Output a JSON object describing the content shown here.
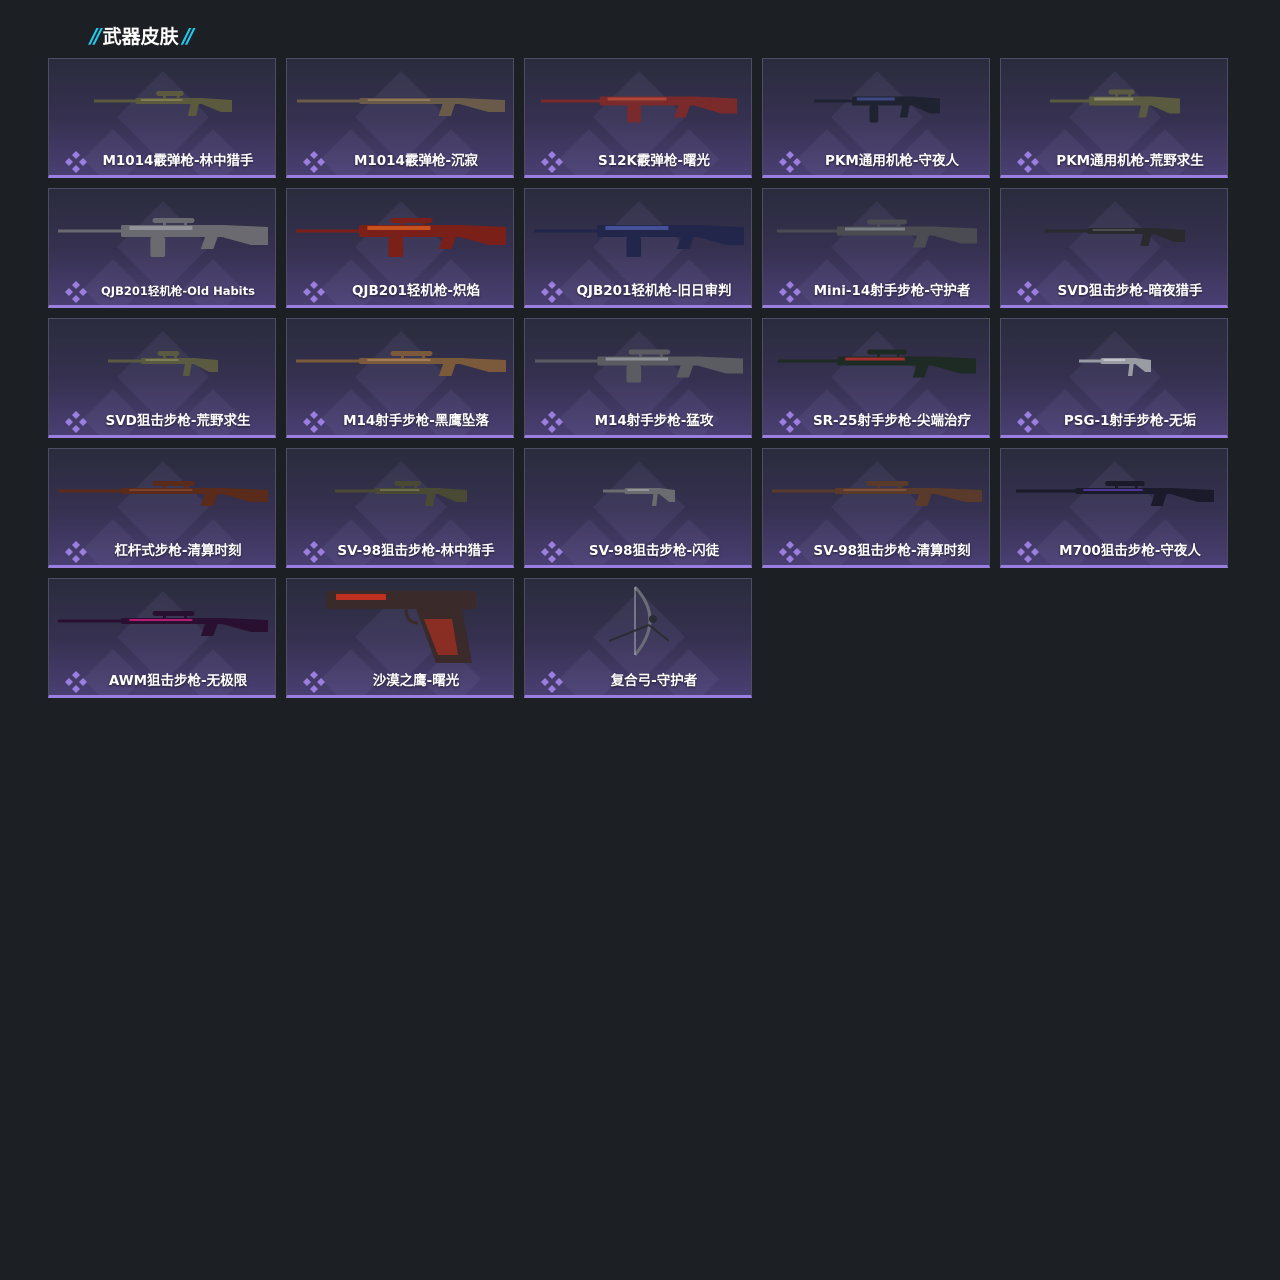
{
  "section": {
    "title": "武器皮肤",
    "accent": "#1ecbf0"
  },
  "card_style": {
    "rarity_color": "#9b7fe0",
    "border_color": "#4e4d66"
  },
  "skins": [
    {
      "name": "M1014霰弹枪-林中猎手",
      "icon": "m1014-shotgun-camo-icon"
    },
    {
      "name": "M1014霰弹枪-沉寂",
      "icon": "m1014-shotgun-bronze-icon"
    },
    {
      "name": "S12K霰弹枪-曙光",
      "icon": "s12k-shotgun-red-icon"
    },
    {
      "name": "PKM通用机枪-守夜人",
      "icon": "pkm-machine-gun-blue-icon"
    },
    {
      "name": "PKM通用机枪-荒野求生",
      "icon": "pkm-machine-gun-camo-icon"
    },
    {
      "name": "QJB201轻机枪-Old Habits",
      "icon": "qjb201-lmg-grey-icon"
    },
    {
      "name": "QJB201轻机枪-炽焰",
      "icon": "qjb201-lmg-flame-icon"
    },
    {
      "name": "QJB201轻机枪-旧日审判",
      "icon": "qjb201-lmg-blue-icon"
    },
    {
      "name": "Mini-14射手步枪-守护者",
      "icon": "mini14-rifle-grey-icon"
    },
    {
      "name": "SVD狙击步枪-暗夜猎手",
      "icon": "svd-sniper-dark-icon"
    },
    {
      "name": "SVD狙击步枪-荒野求生",
      "icon": "svd-sniper-camo-icon"
    },
    {
      "name": "M14射手步枪-黑鹰坠落",
      "icon": "m14-rifle-wood-icon"
    },
    {
      "name": "M14射手步枪-猛攻",
      "icon": "m14-rifle-silver-icon"
    },
    {
      "name": "SR-25射手步枪-尖端治疗",
      "icon": "sr25-rifle-medic-icon"
    },
    {
      "name": "PSG-1射手步枪-无垢",
      "icon": "psg1-rifle-white-icon"
    },
    {
      "name": "杠杆式步枪-清算时刻",
      "icon": "lever-action-rifle-icon"
    },
    {
      "name": "SV-98狙击步枪-林中猎手",
      "icon": "sv98-sniper-camo-icon"
    },
    {
      "name": "SV-98狙击步枪-闪徒",
      "icon": "sv98-sniper-grey-icon"
    },
    {
      "name": "SV-98狙击步枪-清算时刻",
      "icon": "sv98-sniper-wood-icon"
    },
    {
      "name": "M700狙击步枪-守夜人",
      "icon": "m700-sniper-purple-icon"
    },
    {
      "name": "AWM狙击步枪-无极限",
      "icon": "awm-sniper-pink-icon"
    },
    {
      "name": "沙漠之鹰-曙光",
      "icon": "desert-eagle-pistol-icon"
    },
    {
      "name": "复合弓-守护者",
      "icon": "compound-bow-icon"
    }
  ]
}
